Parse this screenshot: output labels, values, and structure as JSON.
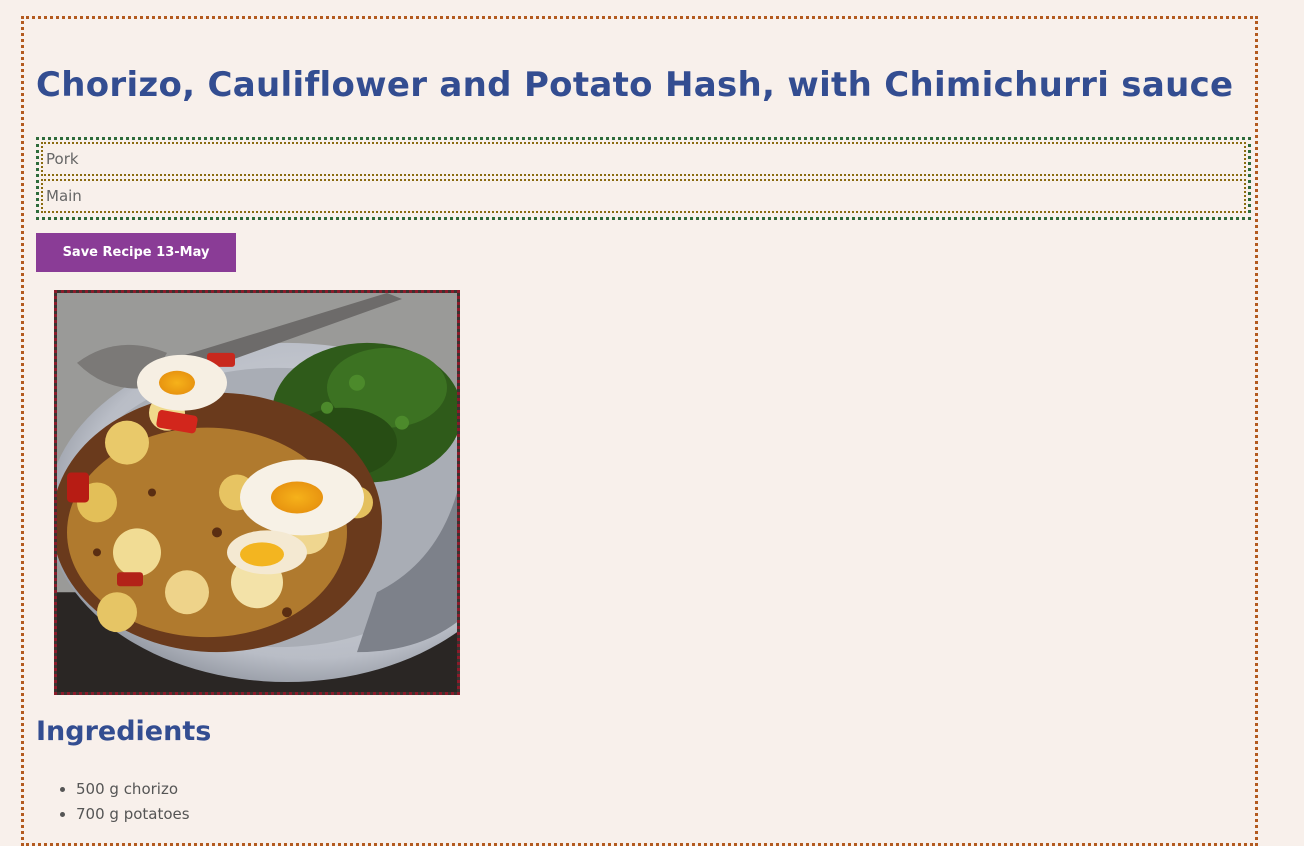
{
  "recipe": {
    "title": "Chorizo, Cauliflower and Potato Hash, with Chimichurri sauce",
    "categories": [
      "Pork",
      "Main"
    ],
    "save_button_label": "Save Recipe 13-May"
  },
  "ingredients": {
    "heading": "Ingredients",
    "items": [
      "500 g chorizo",
      "700 g potatoes"
    ]
  },
  "colors": {
    "page_background": "#f8f0eb",
    "heading": "#334d91",
    "button": "#8a3c96",
    "page_border": "#b35a1f",
    "category_box_border": "#2e6b3a",
    "category_item_border": "#8a6b10",
    "photo_border": "#8b1a2a"
  }
}
